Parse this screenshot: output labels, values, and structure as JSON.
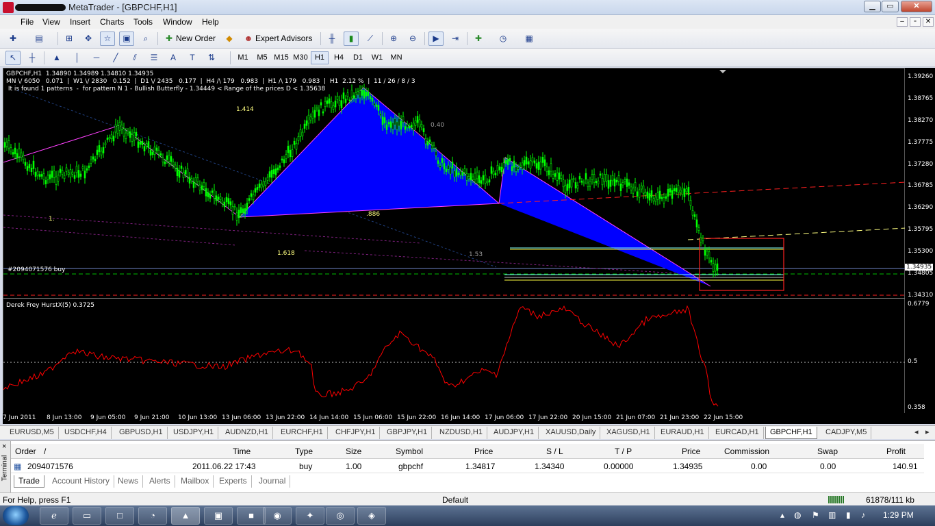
{
  "window": {
    "title": "MetaTrader - [GBPCHF,H1]",
    "buttons": {
      "minimize": "▁",
      "maximize": "▭",
      "close": "✕"
    }
  },
  "menu": {
    "items": [
      "File",
      "View",
      "Insert",
      "Charts",
      "Tools",
      "Window",
      "Help"
    ],
    "mdi": [
      "–",
      "▫",
      "✕"
    ]
  },
  "toolbar": {
    "new_order": "New Order",
    "expert_advisors": "Expert Advisors"
  },
  "timeframes": [
    "M1",
    "M5",
    "M15",
    "M30",
    "H1",
    "H4",
    "D1",
    "W1",
    "MN"
  ],
  "active_timeframe": "H1",
  "chart": {
    "header_line1": "GBPCHF,H1  1.34890 1.34989 1.34810 1.34935",
    "header_line2": "MN \\/ 6050   0.071  |  W1 \\/ 2830   0.152  |  D1 \\/ 2435   0.177  |  H4 /\\ 179   0.983  |  H1 /\\ 179   0.983  |  H1  2.12 %  |  11 / 26 / 8 / 3",
    "header_line3": " It is found 1 patterns  -  for pattern N 1 - Bullish Butterfly - 1.34449 < Range of the prices D < 1.35638",
    "order_label": "#2094071576 buy",
    "fib_labels": {
      "f1414": "1.414",
      "f040": "0.40",
      "f1": "1.",
      "f886": ".886",
      "f1618": "1.618",
      "f153": "1.53"
    },
    "indicator_label": "Derek Frey HurstX(5) 0.3725",
    "price_axis": [
      "1.39260",
      "1.38765",
      "1.38270",
      "1.37775",
      "1.37280",
      "1.36785",
      "1.36290",
      "1.35795",
      "1.35300",
      "1.34805",
      "1.34310"
    ],
    "current_price": "1.34935",
    "indicator_axis": [
      "0.6779",
      "0.5",
      "0.358"
    ],
    "time_axis": [
      "7 Jun 2011",
      "8 Jun 13:00",
      "9 Jun 05:00",
      "9 Jun 21:00",
      "10 Jun 13:00",
      "13 Jun 06:00",
      "13 Jun 22:00",
      "14 Jun 14:00",
      "15 Jun 06:00",
      "15 Jun 22:00",
      "16 Jun 14:00",
      "17 Jun 06:00",
      "17 Jun 22:00",
      "20 Jun 15:00",
      "21 Jun 07:00",
      "21 Jun 23:00",
      "22 Jun 15:00"
    ],
    "colors": {
      "candles": "#00ff00",
      "pattern_fill": "#0000ff",
      "zigzag": "#ff00ff",
      "indicator": "#ff0000",
      "box": "#ff0000"
    }
  },
  "symbol_tabs": [
    "EURUSD,M5",
    "USDCHF,H4",
    "GBPUSD,H1",
    "USDJPY,H1",
    "AUDNZD,H1",
    "EURCHF,H1",
    "CHFJPY,H1",
    "GBPJPY,H1",
    "NZDUSD,H1",
    "AUDJPY,H1",
    "XAUUSD,Daily",
    "XAGUSD,H1",
    "EURAUD,H1",
    "EURCAD,H1",
    "GBPCHF,H1",
    "CADJPY,M5"
  ],
  "active_symbol_tab": "GBPCHF,H1",
  "terminal": {
    "side_label": "Terminal",
    "close": "×",
    "columns": [
      "Order",
      "/",
      "Time",
      "Type",
      "Size",
      "Symbol",
      "Price",
      "S / L",
      "T / P",
      "Price",
      "Commission",
      "Swap",
      "Profit"
    ],
    "row": {
      "order": "2094071576",
      "time": "2011.06.22 17:43",
      "type": "buy",
      "size": "1.00",
      "symbol": "gbpchf",
      "price": "1.34817",
      "sl": "1.34340",
      "tp": "0.00000",
      "current_price": "1.34935",
      "commission": "0.00",
      "swap": "0.00",
      "profit": "140.91"
    },
    "tabs": [
      "Trade",
      "Account History",
      "News",
      "Alerts",
      "Mailbox",
      "Experts",
      "Journal"
    ],
    "active_tab": "Trade"
  },
  "status": {
    "help": "For Help, press F1",
    "profile": "Default",
    "traffic": "61878/111 kb"
  },
  "taskbar": {
    "clock": "1:29 PM"
  }
}
